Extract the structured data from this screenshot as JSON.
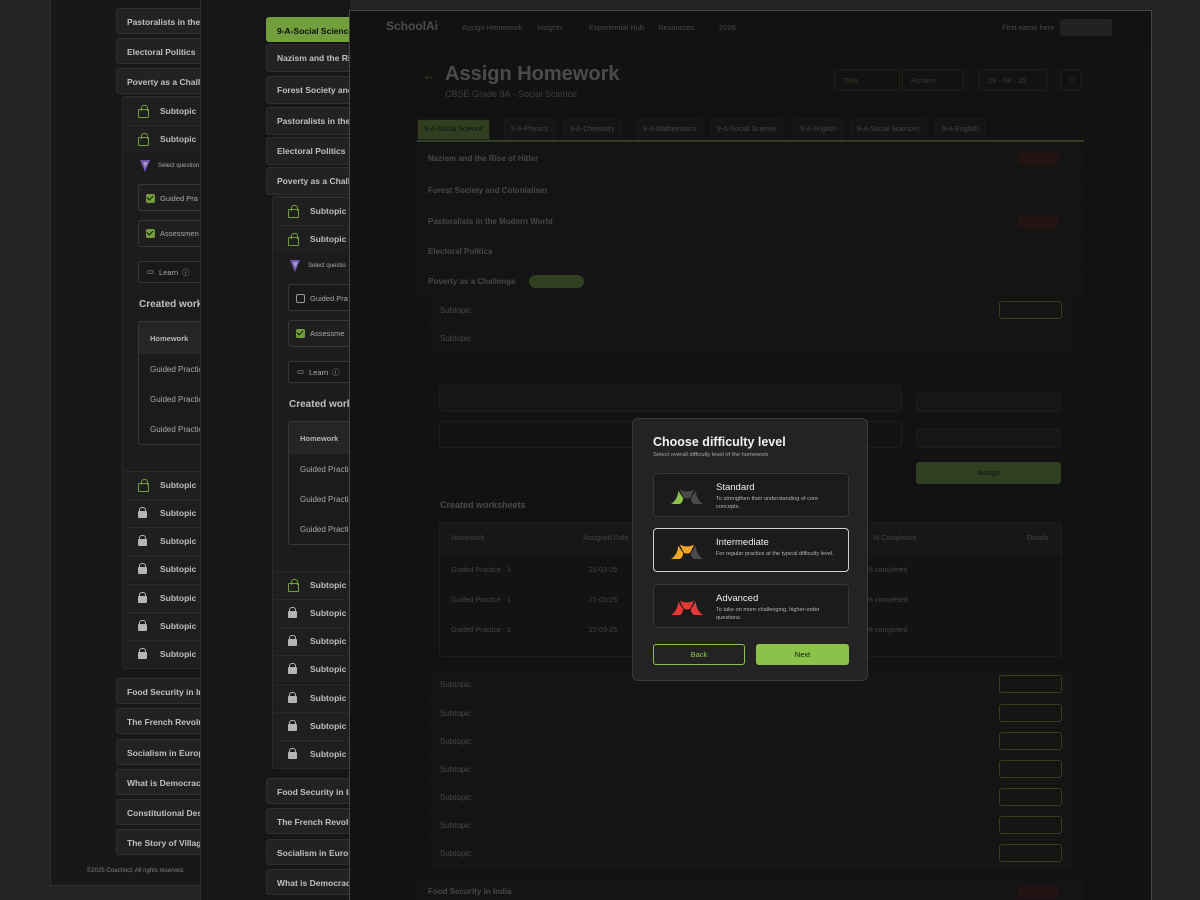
{
  "panel_left": {
    "topics_top": [
      "Pastoralists in the",
      "Electoral Politics",
      "Poverty as a Chall"
    ],
    "subtopic_label": "Subtopic",
    "select_text": "Select question",
    "guided": "Guided Pra",
    "assessment": "Assessmen",
    "learn": "Learn",
    "created": "Created work",
    "table_header": "Homework",
    "table_rows": [
      "Guided Practic",
      "Guided Practic",
      "Guided Practic"
    ],
    "topics_bottom": [
      "Food Security in In",
      "The French Revolu",
      "Socialism in Europ",
      "What is Democrac",
      "Constitutional Des",
      "The Story of Villag"
    ],
    "footer": "©2025 Coachool, All rights reserved."
  },
  "panel_mid": {
    "class_tab": "9-A-Social Science",
    "topics_top": [
      "Nazism and the Ri",
      "Forest Society and",
      "Pastoralists in the",
      "Electoral Politics",
      "Poverty as a Chall"
    ],
    "subtopic_label": "Subtopic",
    "select_text": "Select questio",
    "guided": "Guided Pra",
    "assessment": "Assessme",
    "learn": "Learn",
    "created": "Created work",
    "table_header": "Homework",
    "table_rows": [
      "Guided Practi",
      "Guided Practi",
      "Guided Practi"
    ],
    "topics_bottom": [
      "Food Security in In",
      "The French Revolu",
      "Socialism in Europ",
      "What is Democrac"
    ]
  },
  "main": {
    "logo": "SchoolAi",
    "nav": [
      "Assign Homework",
      "Insights",
      "Experiential Hub",
      "Resources",
      "2026"
    ],
    "user": "First name here",
    "title": "Assign Homework",
    "subtitle": "CBSE Grade 9A · Social Science",
    "view_buttons": [
      "Tiles",
      "Rosters"
    ],
    "date": "29 · 04 · 25",
    "class_tabs": [
      "9-A-Social Science",
      "9-A-Physics",
      "9-A-Chemistry",
      "9-A-Mathematics",
      "9-A-Social Science",
      "9-A-English",
      "9-A-Social Sciences",
      "9-A-English"
    ],
    "topics": [
      "Nazism and the Rise of Hitler",
      "Forest Society and Colonialism",
      "Pastoralists in the Modern World",
      "Electoral Politics",
      "Poverty as a Challenge"
    ],
    "subtopic": "Subtopic",
    "created": "Created worksheets",
    "table_cols": [
      "Homework",
      "Assigned Date",
      "% Completion",
      "Details"
    ],
    "rows": [
      {
        "name": "Guided Practice · 1",
        "date": "21-03-25",
        "pct": "% completed"
      },
      {
        "name": "Guided Practice · 1",
        "date": "21-03-25",
        "pct": "% completed"
      },
      {
        "name": "Guided Practice · 1",
        "date": "21-03-25",
        "pct": "% completed"
      }
    ],
    "assign": "Assign",
    "homework_btn": "Homework",
    "food_security": "Food Security in India"
  },
  "modal": {
    "title": "Choose difficulty level",
    "subtitle": "Select overall difficulty level of the homework",
    "options": [
      {
        "title": "Standard",
        "desc": "To strengthen their understanding of core concepts.",
        "color": "#8bc34a",
        "level": 1
      },
      {
        "title": "Intermediate",
        "desc": "For regular practice at the typical difficulty level.",
        "color": "#f5a623",
        "level": 2
      },
      {
        "title": "Advanced",
        "desc": "To take on more challenging, higher-order questions.",
        "color": "#e53935",
        "level": 3
      }
    ],
    "selected": "Intermediate",
    "back": "Back",
    "next": "Next"
  }
}
